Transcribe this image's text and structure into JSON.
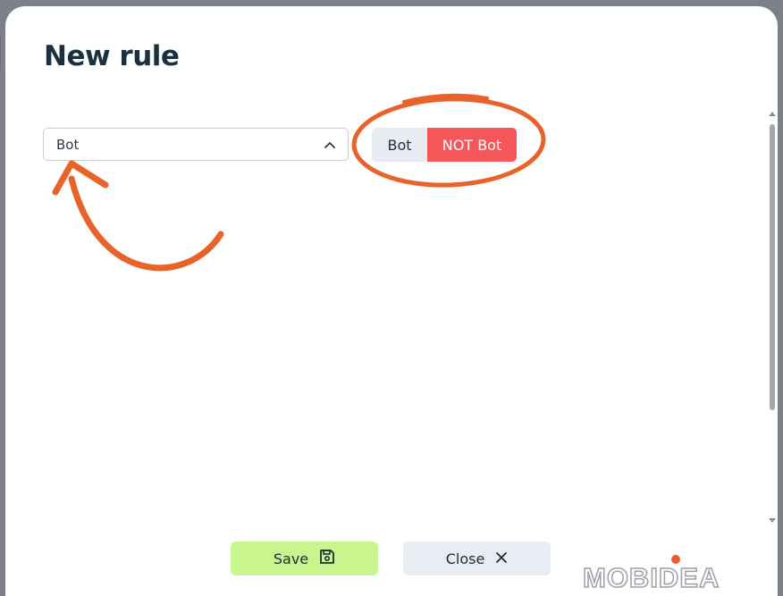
{
  "dialog": {
    "title": "New rule",
    "select": {
      "value": "Bot"
    },
    "toggle": {
      "options": [
        "Bot",
        "NOT Bot"
      ],
      "selected": "NOT Bot"
    },
    "buttons": {
      "save_label": "Save",
      "close_label": "Close"
    }
  },
  "watermark": {
    "text": "MOBIDEA"
  },
  "colors": {
    "accent_save": "#c9f58e",
    "active_toggle": "#f4565a",
    "annotation": "#e8622a"
  }
}
